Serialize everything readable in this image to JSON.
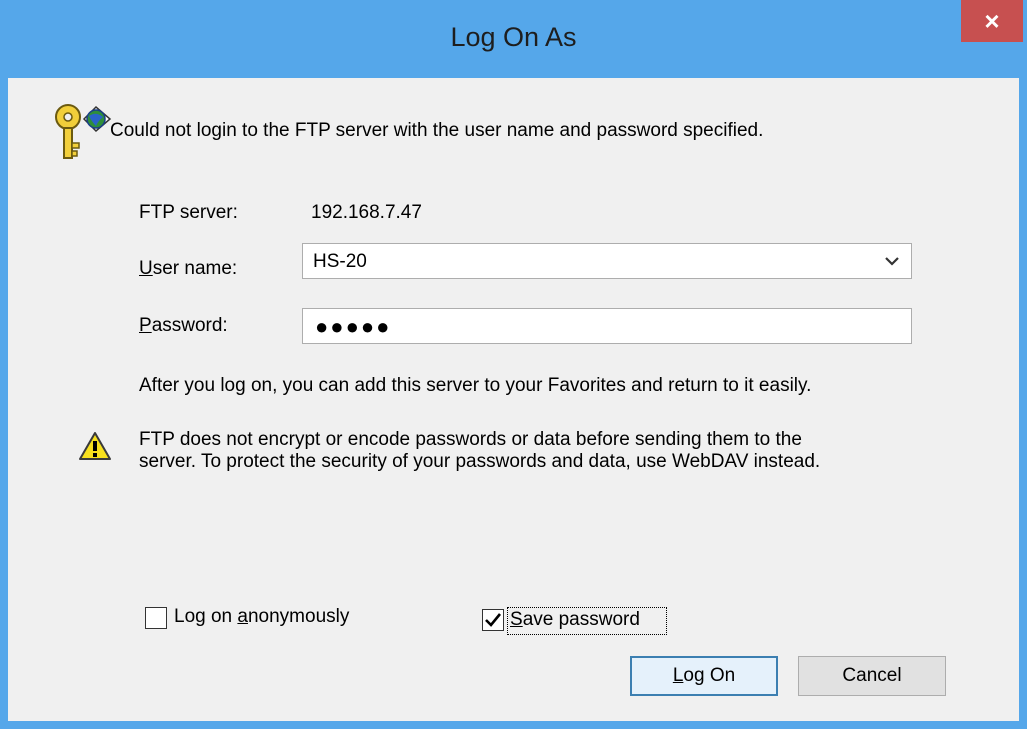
{
  "window": {
    "title": "Log On As",
    "close_glyph": "×"
  },
  "message": {
    "error": "Could not login to the FTP server with the user name and password specified.",
    "icon": "key-globe-icon"
  },
  "fields": {
    "server_label": "FTP server:",
    "server_value": "192.168.7.47",
    "username_label_first": "U",
    "username_label_rest": "ser name:",
    "username_value": "HS-20",
    "password_label_first": "P",
    "password_label_rest": "assword:",
    "password_value": "●●●●●"
  },
  "info": {
    "favorites": "After you log on, you can add this server to your Favorites and return to it easily.",
    "warning_line1": "FTP does not encrypt or encode passwords or data before sending them to the",
    "warning_line2": "server.  To protect the security of your passwords and data, use WebDAV instead.",
    "warning_icon": "warning-icon"
  },
  "options": {
    "anonymous_pre": "Log on ",
    "anonymous_u": "a",
    "anonymous_post": "nonymously",
    "anonymous_checked": false,
    "save_u": "S",
    "save_post": "ave password",
    "save_checked": true
  },
  "buttons": {
    "logon_u": "L",
    "logon_post": "og On",
    "cancel": "Cancel"
  },
  "colors": {
    "titlebar": "#55a7ea",
    "close": "#c75050",
    "client": "#f0f0f0"
  }
}
